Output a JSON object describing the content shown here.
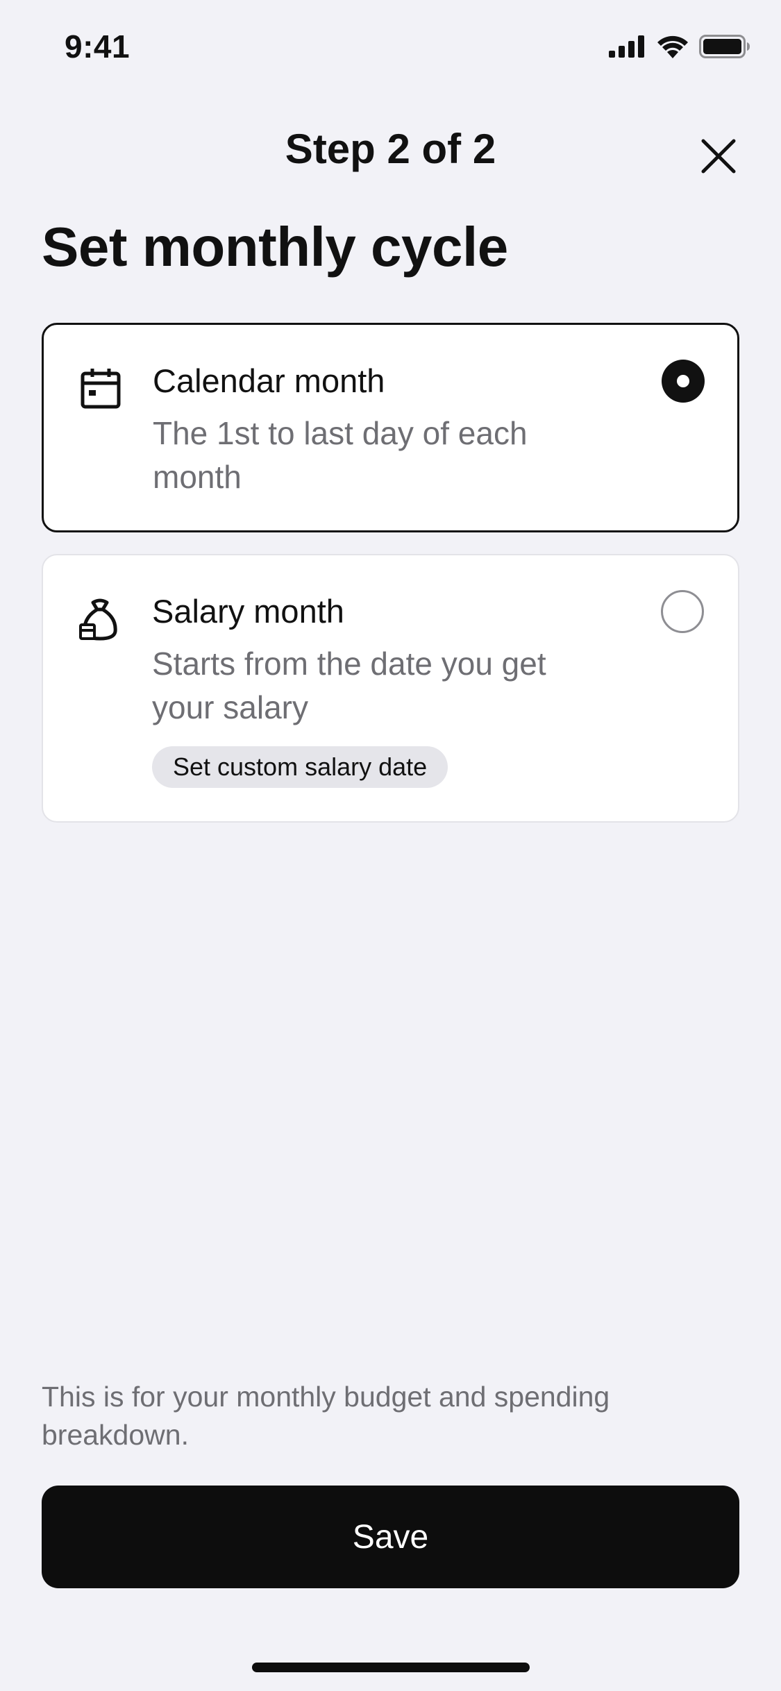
{
  "status_bar": {
    "time": "9:41",
    "icons": [
      "cellular-signal-icon",
      "wifi-icon",
      "battery-icon"
    ]
  },
  "header": {
    "step": "Step 2 of 2",
    "close_icon": "close-icon"
  },
  "page_title": "Set monthly cycle",
  "options": [
    {
      "icon": "calendar-icon",
      "title": "Calendar month",
      "description": "The 1st to last day of each month",
      "selected": true
    },
    {
      "icon": "money-bag-icon",
      "title": "Salary month",
      "description": "Starts from the date you get your salary",
      "selected": false,
      "chip_label": "Set custom salary date"
    }
  ],
  "footer": {
    "note": "This is for your monthly budget and spending breakdown.",
    "save_label": "Save"
  },
  "colors": {
    "background": "#F2F2F7",
    "card": "#FFFFFF",
    "text_primary": "#111111",
    "text_secondary": "#6E6E73",
    "chip": "#E5E5EA",
    "button": "#0D0D0D"
  }
}
